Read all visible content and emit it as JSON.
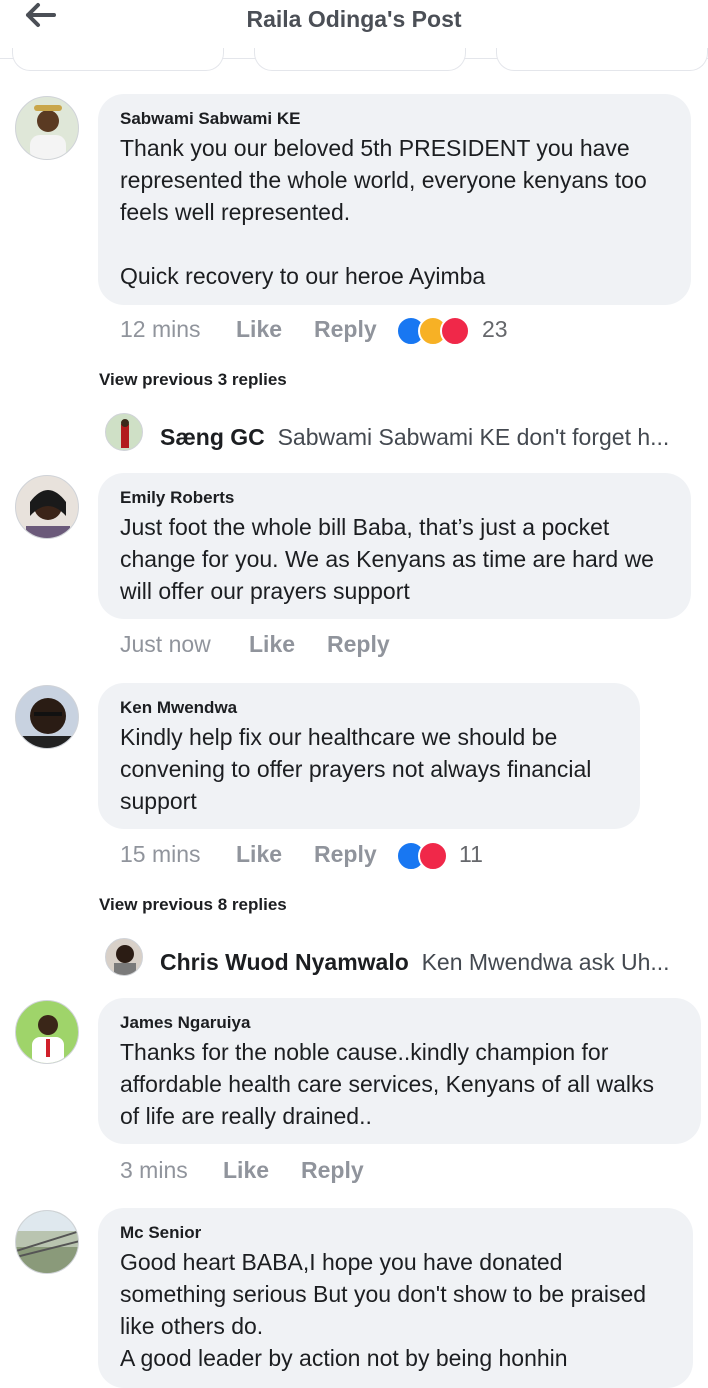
{
  "header": {
    "title": "Raila Odinga's Post",
    "back_icon": "back-arrow-icon"
  },
  "comments": [
    {
      "author": "Sabwami Sabwami KE",
      "text": "Thank you our beloved 5th PRESIDENT you have represented the whole world, everyone kenyans too feels well represented.\n\nQuick recovery to our heroe Ayimba",
      "time": "12 mins",
      "like": "Like",
      "reply": "Reply",
      "reaction_count": "23",
      "reactions": [
        "like",
        "haha",
        "love"
      ]
    },
    {
      "author": "Emily Roberts",
      "text": "Just foot the whole bill Baba, that’s just a pocket change for you. We as Kenyans as time are hard we will offer our prayers support",
      "time": "Just now",
      "like": "Like",
      "reply": "Reply"
    },
    {
      "author": "Ken Mwendwa",
      "text": "Kindly help fix our healthcare we should be convening to offer prayers not always financial support",
      "time": "15 mins",
      "like": "Like",
      "reply": "Reply",
      "reaction_count": "11",
      "reactions": [
        "like",
        "love"
      ]
    },
    {
      "author": "James Ngaruiya",
      "text": "Thanks for the noble cause..kindly champion for affordable health care services, Kenyans of all walks of life are really drained..",
      "time": "3 mins",
      "like": "Like",
      "reply": "Reply"
    },
    {
      "author": "Mc Senior",
      "text": "Good heart BABA,I hope you have donated something serious But you don't show to be praised like others do.\nA good leader by action not by being honhin",
      "time": "",
      "like": "",
      "reply": ""
    }
  ],
  "replies": [
    {
      "view_previous": "View previous 3 replies",
      "name": "Sæng GC",
      "text": "Sabwami Sabwami KE don't forget h..."
    },
    {
      "view_previous": "View previous 8 replies",
      "name": "Chris Wuod Nyamwalo",
      "text": "Ken Mwendwa ask Uh..."
    }
  ],
  "colors": {
    "bubble": "#f0f2f5",
    "like": "#1877f2",
    "love": "#f02849",
    "haha": "#f7b125",
    "meta": "#90949c"
  }
}
